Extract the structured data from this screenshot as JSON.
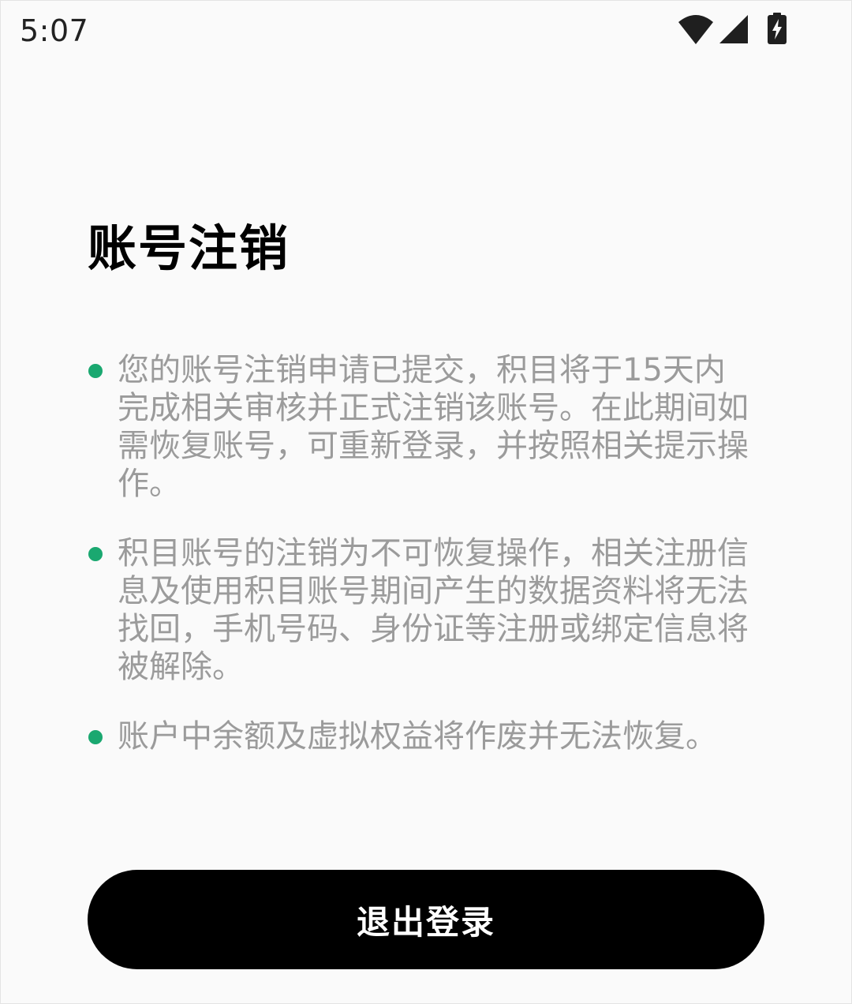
{
  "status_bar": {
    "time": "5:07",
    "icons": [
      "wifi-icon",
      "signal-icon",
      "battery-charging-icon"
    ],
    "icon_color": "#1f1f1f"
  },
  "page": {
    "title": "账号注销",
    "notices": [
      {
        "text": "您的账号注销申请已提交，积目将于15天内完成相关审核并正式注销该账号。在此期间如需恢复账号，可重新登录，并按照相关提示操作。"
      },
      {
        "text": "积目账号的注销为不可恢复操作，相关注册信息及使用积目账号期间产生的数据资料将无法找回，手机号码、身份证等注册或绑定信息将被解除。"
      },
      {
        "text": "账户中余额及虚拟权益将作废并无法恢复。"
      }
    ]
  },
  "actions": {
    "logout_label": "退出登录"
  },
  "colors": {
    "background": "#fafafa",
    "title": "#000000",
    "body_text": "#9b9b9b",
    "bullet_accent": "#1aa870",
    "button_bg": "#000000",
    "button_text": "#ffffff"
  }
}
